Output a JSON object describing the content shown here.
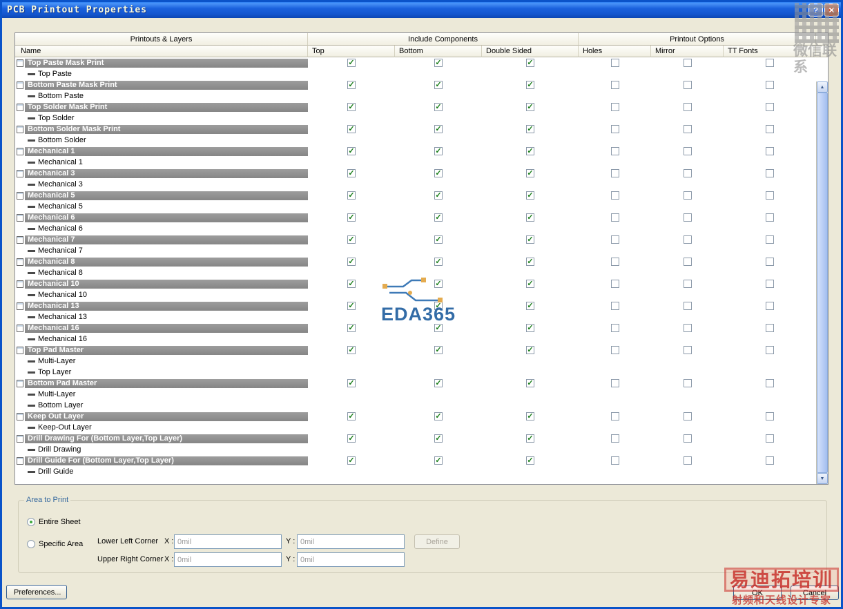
{
  "window": {
    "title": "PCB Printout Properties",
    "help_glyph": "?",
    "close_glyph": "✕"
  },
  "icons": {
    "check_glyph": "✓",
    "up_arrow": "▲",
    "down_arrow": "▼"
  },
  "table": {
    "group_headers": [
      "Printouts & Layers",
      "Include Components",
      "Printout Options"
    ],
    "columns": [
      "Name",
      "Top",
      "Bottom",
      "Double Sided",
      "Holes",
      "Mirror",
      "TT Fonts"
    ],
    "rows": [
      {
        "name": "Top Paste Mask Print",
        "layers": [
          "Top Paste"
        ],
        "include": {
          "top": true,
          "bottom": true,
          "double_sided": true
        },
        "options": {
          "holes": false,
          "mirror": false,
          "tt_fonts": false
        }
      },
      {
        "name": "Bottom Paste Mask Print",
        "layers": [
          "Bottom Paste"
        ],
        "include": {
          "top": true,
          "bottom": true,
          "double_sided": true
        },
        "options": {
          "holes": false,
          "mirror": false,
          "tt_fonts": false
        }
      },
      {
        "name": "Top Solder Mask Print",
        "layers": [
          "Top Solder"
        ],
        "include": {
          "top": true,
          "bottom": true,
          "double_sided": true
        },
        "options": {
          "holes": false,
          "mirror": false,
          "tt_fonts": false
        }
      },
      {
        "name": "Bottom Solder Mask Print",
        "layers": [
          "Bottom Solder"
        ],
        "include": {
          "top": true,
          "bottom": true,
          "double_sided": true
        },
        "options": {
          "holes": false,
          "mirror": false,
          "tt_fonts": false
        }
      },
      {
        "name": "Mechanical 1",
        "layers": [
          "Mechanical 1"
        ],
        "include": {
          "top": true,
          "bottom": true,
          "double_sided": true
        },
        "options": {
          "holes": false,
          "mirror": false,
          "tt_fonts": false
        }
      },
      {
        "name": "Mechanical 3",
        "layers": [
          "Mechanical 3"
        ],
        "include": {
          "top": true,
          "bottom": true,
          "double_sided": true
        },
        "options": {
          "holes": false,
          "mirror": false,
          "tt_fonts": false
        }
      },
      {
        "name": "Mechanical 5",
        "layers": [
          "Mechanical 5"
        ],
        "include": {
          "top": true,
          "bottom": true,
          "double_sided": true
        },
        "options": {
          "holes": false,
          "mirror": false,
          "tt_fonts": false
        }
      },
      {
        "name": "Mechanical 6",
        "layers": [
          "Mechanical 6"
        ],
        "include": {
          "top": true,
          "bottom": true,
          "double_sided": true
        },
        "options": {
          "holes": false,
          "mirror": false,
          "tt_fonts": false
        }
      },
      {
        "name": "Mechanical 7",
        "layers": [
          "Mechanical 7"
        ],
        "include": {
          "top": true,
          "bottom": true,
          "double_sided": true
        },
        "options": {
          "holes": false,
          "mirror": false,
          "tt_fonts": false
        }
      },
      {
        "name": "Mechanical 8",
        "layers": [
          "Mechanical 8"
        ],
        "include": {
          "top": true,
          "bottom": true,
          "double_sided": true
        },
        "options": {
          "holes": false,
          "mirror": false,
          "tt_fonts": false
        }
      },
      {
        "name": "Mechanical 10",
        "layers": [
          "Mechanical 10"
        ],
        "include": {
          "top": true,
          "bottom": true,
          "double_sided": true
        },
        "options": {
          "holes": false,
          "mirror": false,
          "tt_fonts": false
        }
      },
      {
        "name": "Mechanical 13",
        "layers": [
          "Mechanical 13"
        ],
        "include": {
          "top": true,
          "bottom": true,
          "double_sided": true
        },
        "options": {
          "holes": false,
          "mirror": false,
          "tt_fonts": false
        }
      },
      {
        "name": "Mechanical 16",
        "layers": [
          "Mechanical 16"
        ],
        "include": {
          "top": true,
          "bottom": true,
          "double_sided": true
        },
        "options": {
          "holes": false,
          "mirror": false,
          "tt_fonts": false
        }
      },
      {
        "name": "Top Pad Master",
        "layers": [
          "Multi-Layer",
          "Top Layer"
        ],
        "include": {
          "top": true,
          "bottom": true,
          "double_sided": true
        },
        "options": {
          "holes": false,
          "mirror": false,
          "tt_fonts": false
        }
      },
      {
        "name": "Bottom Pad Master",
        "layers": [
          "Multi-Layer",
          "Bottom Layer"
        ],
        "include": {
          "top": true,
          "bottom": true,
          "double_sided": true
        },
        "options": {
          "holes": false,
          "mirror": false,
          "tt_fonts": false
        }
      },
      {
        "name": "Keep Out Layer",
        "layers": [
          "Keep-Out Layer"
        ],
        "include": {
          "top": true,
          "bottom": true,
          "double_sided": true
        },
        "options": {
          "holes": false,
          "mirror": false,
          "tt_fonts": false
        }
      },
      {
        "name": "Drill Drawing For (Bottom Layer,Top Layer)",
        "layers": [
          "Drill Drawing"
        ],
        "include": {
          "top": true,
          "bottom": true,
          "double_sided": true
        },
        "options": {
          "holes": false,
          "mirror": false,
          "tt_fonts": false
        }
      },
      {
        "name": "Drill Guide For (Bottom Layer,Top Layer)",
        "layers": [
          "Drill Guide"
        ],
        "include": {
          "top": true,
          "bottom": true,
          "double_sided": true
        },
        "options": {
          "holes": false,
          "mirror": false,
          "tt_fonts": false
        }
      }
    ]
  },
  "area_to_print": {
    "label": "Area to Print",
    "selected": "entire_sheet",
    "entire_sheet": "Entire Sheet",
    "specific_area": "Specific Area",
    "lower_left_label": "Lower Left Corner",
    "upper_right_label": "Upper Right Corner",
    "x_label": "X :",
    "y_label": "Y :",
    "fields": {
      "ll_x": "0mil",
      "ll_y": "0mil",
      "ur_x": "0mil",
      "ur_y": "0mil"
    },
    "define_button": "Define"
  },
  "footer": {
    "preferences": "Preferences...",
    "ok": "OK",
    "cancel": "Cancel"
  },
  "watermarks": {
    "eda365": "EDA365",
    "wechat": "微信联系",
    "red_title": "易迪拓培训",
    "red_subtitle": "射频和天线设计专家"
  }
}
